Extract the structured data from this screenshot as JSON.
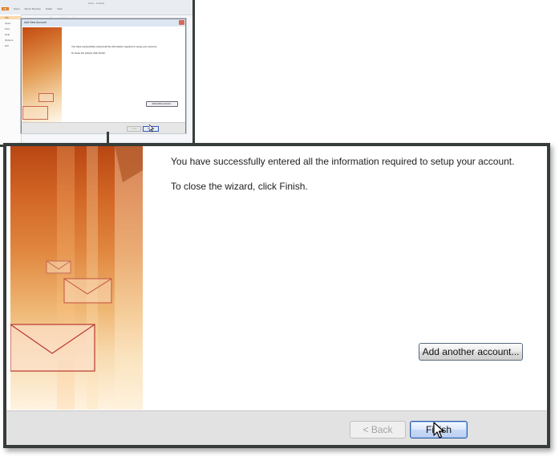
{
  "thumbnail": {
    "window_title": "Inbox - Outlook",
    "tabs": [
      "File",
      "Home",
      "Send / Receive",
      "Folder",
      "View"
    ],
    "left_nav": [
      "Info",
      "Open",
      "Print",
      "Help",
      "Options",
      "Exit"
    ],
    "background_title": "Account Information",
    "background_sub": "",
    "dialog_title": "Add New Account",
    "message1": "You have successfully entered all the information required to setup your account.",
    "message2": "To close the wizard, click Finish.",
    "add_another_label": "Add another account...",
    "back_label": "< Back",
    "finish_label": "Finish"
  },
  "dialog": {
    "message1": "You have successfully entered all the information required to setup your account.",
    "message2": "To close the wizard, click Finish.",
    "add_another_label": "Add another account...",
    "back_label": "< Back",
    "finish_label": "Finish",
    "back_enabled": false
  },
  "colors": {
    "frame": "#363c38",
    "accent_orange": "#d16424",
    "finish_border": "#2c5aa8",
    "footer_bg": "#e2e2e2"
  },
  "icons": {
    "art": "envelope-illustration",
    "cursor": "mouse-pointer-icon"
  }
}
